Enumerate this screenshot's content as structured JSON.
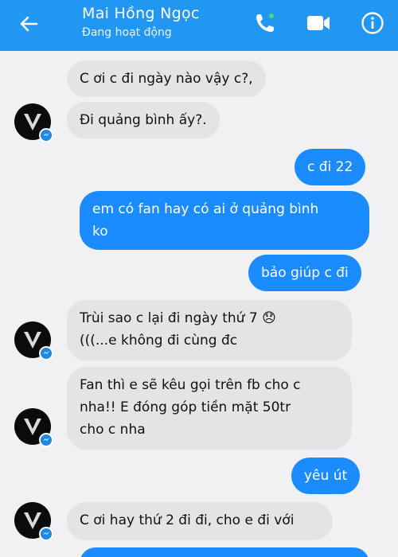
{
  "header": {
    "contact_name": "Mai Hồng Ngọc",
    "status": "Đang hoạt động",
    "bg_color": "#2196f3",
    "icons": [
      "back-arrow-icon",
      "phone-call-icon",
      "video-camera-icon",
      "info-icon"
    ]
  },
  "messages": [
    {
      "sender": "contact",
      "text": "C ơi c đi ngày nào vậy c?,"
    },
    {
      "sender": "contact",
      "text": "Đi quảng bình ấy?."
    },
    {
      "sender": "me",
      "text": "c đi 22"
    },
    {
      "sender": "me",
      "text": "em có fan hay có ai ở quảng bình\nko"
    },
    {
      "sender": "me",
      "text": "bảo giúp c đi"
    },
    {
      "sender": "contact",
      "text": "Trùi sao c lại đi ngày thứ 7 😞\n(((...e không đi cùng đc"
    },
    {
      "sender": "contact",
      "text": "Fan thì e sẽ kêu gọi trên fb cho c\nnha!! E đóng góp tiền mặt 50tr\ncho c nha"
    },
    {
      "sender": "me",
      "text": "yêu út"
    },
    {
      "sender": "contact",
      "text": "C ơi hay thứ 2 đi đi, cho e đi với"
    },
    {
      "sender": "me",
      "text": ""
    }
  ],
  "colors": {
    "incoming_bubble": "#e4e4e6",
    "outgoing_bubble": "#1a8cff",
    "background": "#f1f1f3"
  }
}
